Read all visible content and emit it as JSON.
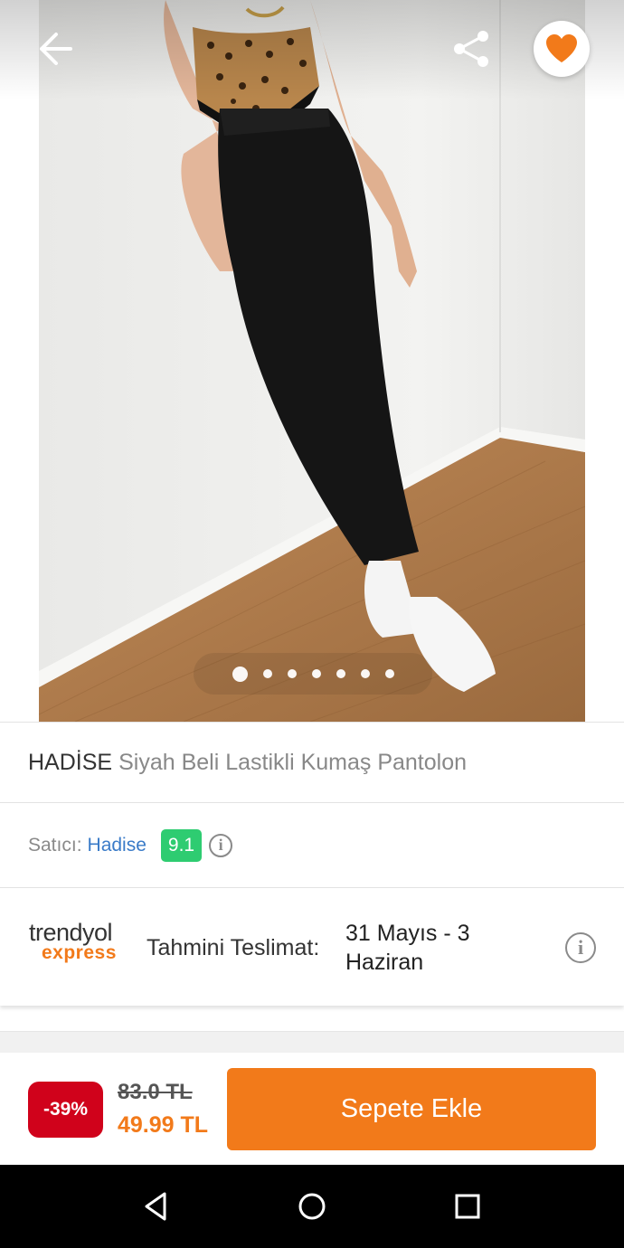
{
  "product": {
    "brand": "HADİSE",
    "name": "Siyah Beli Lastikli Kumaş Pantolon",
    "image_count": 7,
    "active_image_index": 0,
    "is_favorite": true
  },
  "seller": {
    "label": "Satıcı:",
    "name": "Hadise",
    "score": "9.1"
  },
  "delivery": {
    "logo_top": "trendyol",
    "logo_bottom": "express",
    "label": "Tahmini Teslimat:",
    "date": "31 Mayıs - 3 Haziran"
  },
  "pricing": {
    "discount": "-39%",
    "old_price": "83.0 TL",
    "new_price": "49.99 TL",
    "add_to_cart": "Sepete Ekle"
  },
  "icons": {
    "back": "arrow-left-icon",
    "share": "share-icon",
    "favorite": "heart-icon",
    "info": "info-icon",
    "nav_back": "triangle-back-icon",
    "nav_home": "circle-home-icon",
    "nav_recent": "square-recent-icon"
  },
  "colors": {
    "accent": "#f27a1a",
    "discount": "#d0021b",
    "seller_link": "#3a7bc8",
    "score_badge": "#2ecc71"
  }
}
